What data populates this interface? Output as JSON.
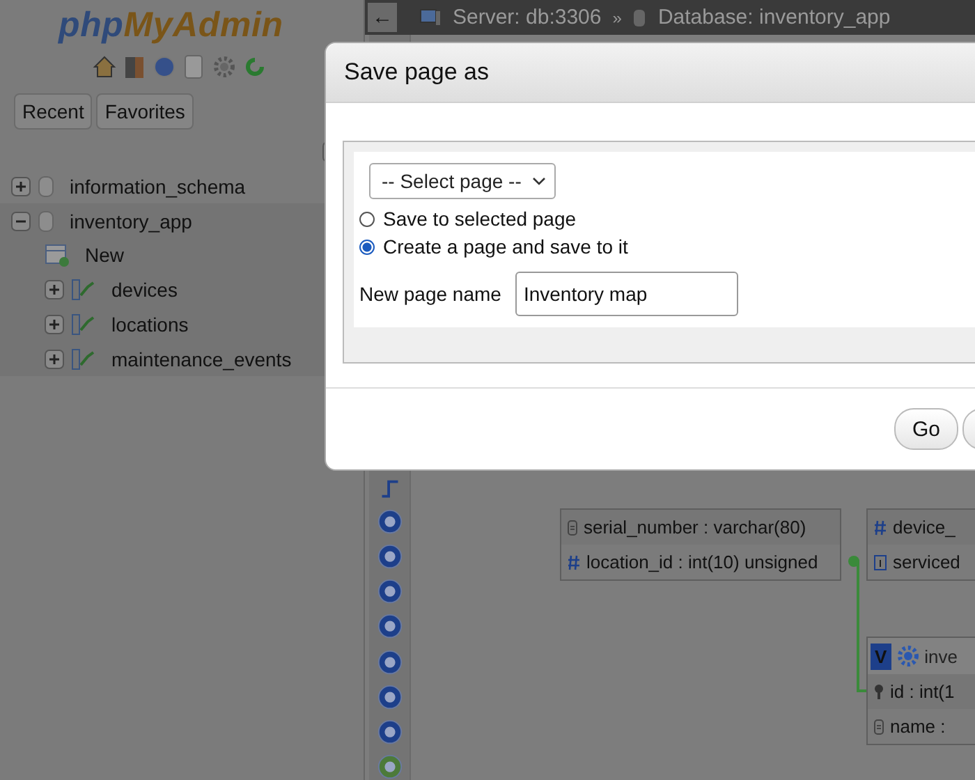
{
  "sidebar": {
    "logo": [
      "php",
      "MyAdmin"
    ],
    "buttons": [
      {
        "label": "Recent"
      },
      {
        "label": "Favorites"
      }
    ],
    "tree": [
      {
        "label": "information_schema",
        "kind": "database",
        "expanded": false
      },
      {
        "label": "inventory_app",
        "kind": "database",
        "expanded": true,
        "children": [
          {
            "label": "New",
            "kind": "new"
          },
          {
            "label": "devices",
            "kind": "table"
          },
          {
            "label": "locations",
            "kind": "table"
          },
          {
            "label": "maintenance_events",
            "kind": "table"
          }
        ]
      }
    ]
  },
  "breadcrumb": {
    "back": "←",
    "server": "Server: db:3306",
    "separator": "»",
    "database": "Database: inventory_app"
  },
  "canvas": {
    "tables": [
      {
        "rows": [
          {
            "kind": "text",
            "label": "serial_number : varchar(80)"
          },
          {
            "kind": "number",
            "label": "location_id : int(10) unsigned"
          }
        ]
      },
      {
        "rows": [
          {
            "kind": "number",
            "label": "device_"
          },
          {
            "kind": "date",
            "label": "serviced"
          }
        ]
      },
      {
        "toggle": "V",
        "header": "inve",
        "rows": [
          {
            "kind": "key",
            "label": "id : int(1"
          },
          {
            "kind": "text",
            "label": "name :"
          }
        ]
      }
    ]
  },
  "dialog": {
    "title": "Save page as",
    "select": "-- Select page --",
    "options": [
      {
        "label": "Save to selected page",
        "selected": false
      },
      {
        "label": "Create a page and save to it",
        "selected": true
      }
    ],
    "name_label": "New page name",
    "name_value": "Inventory map",
    "buttons": [
      "Go"
    ]
  }
}
